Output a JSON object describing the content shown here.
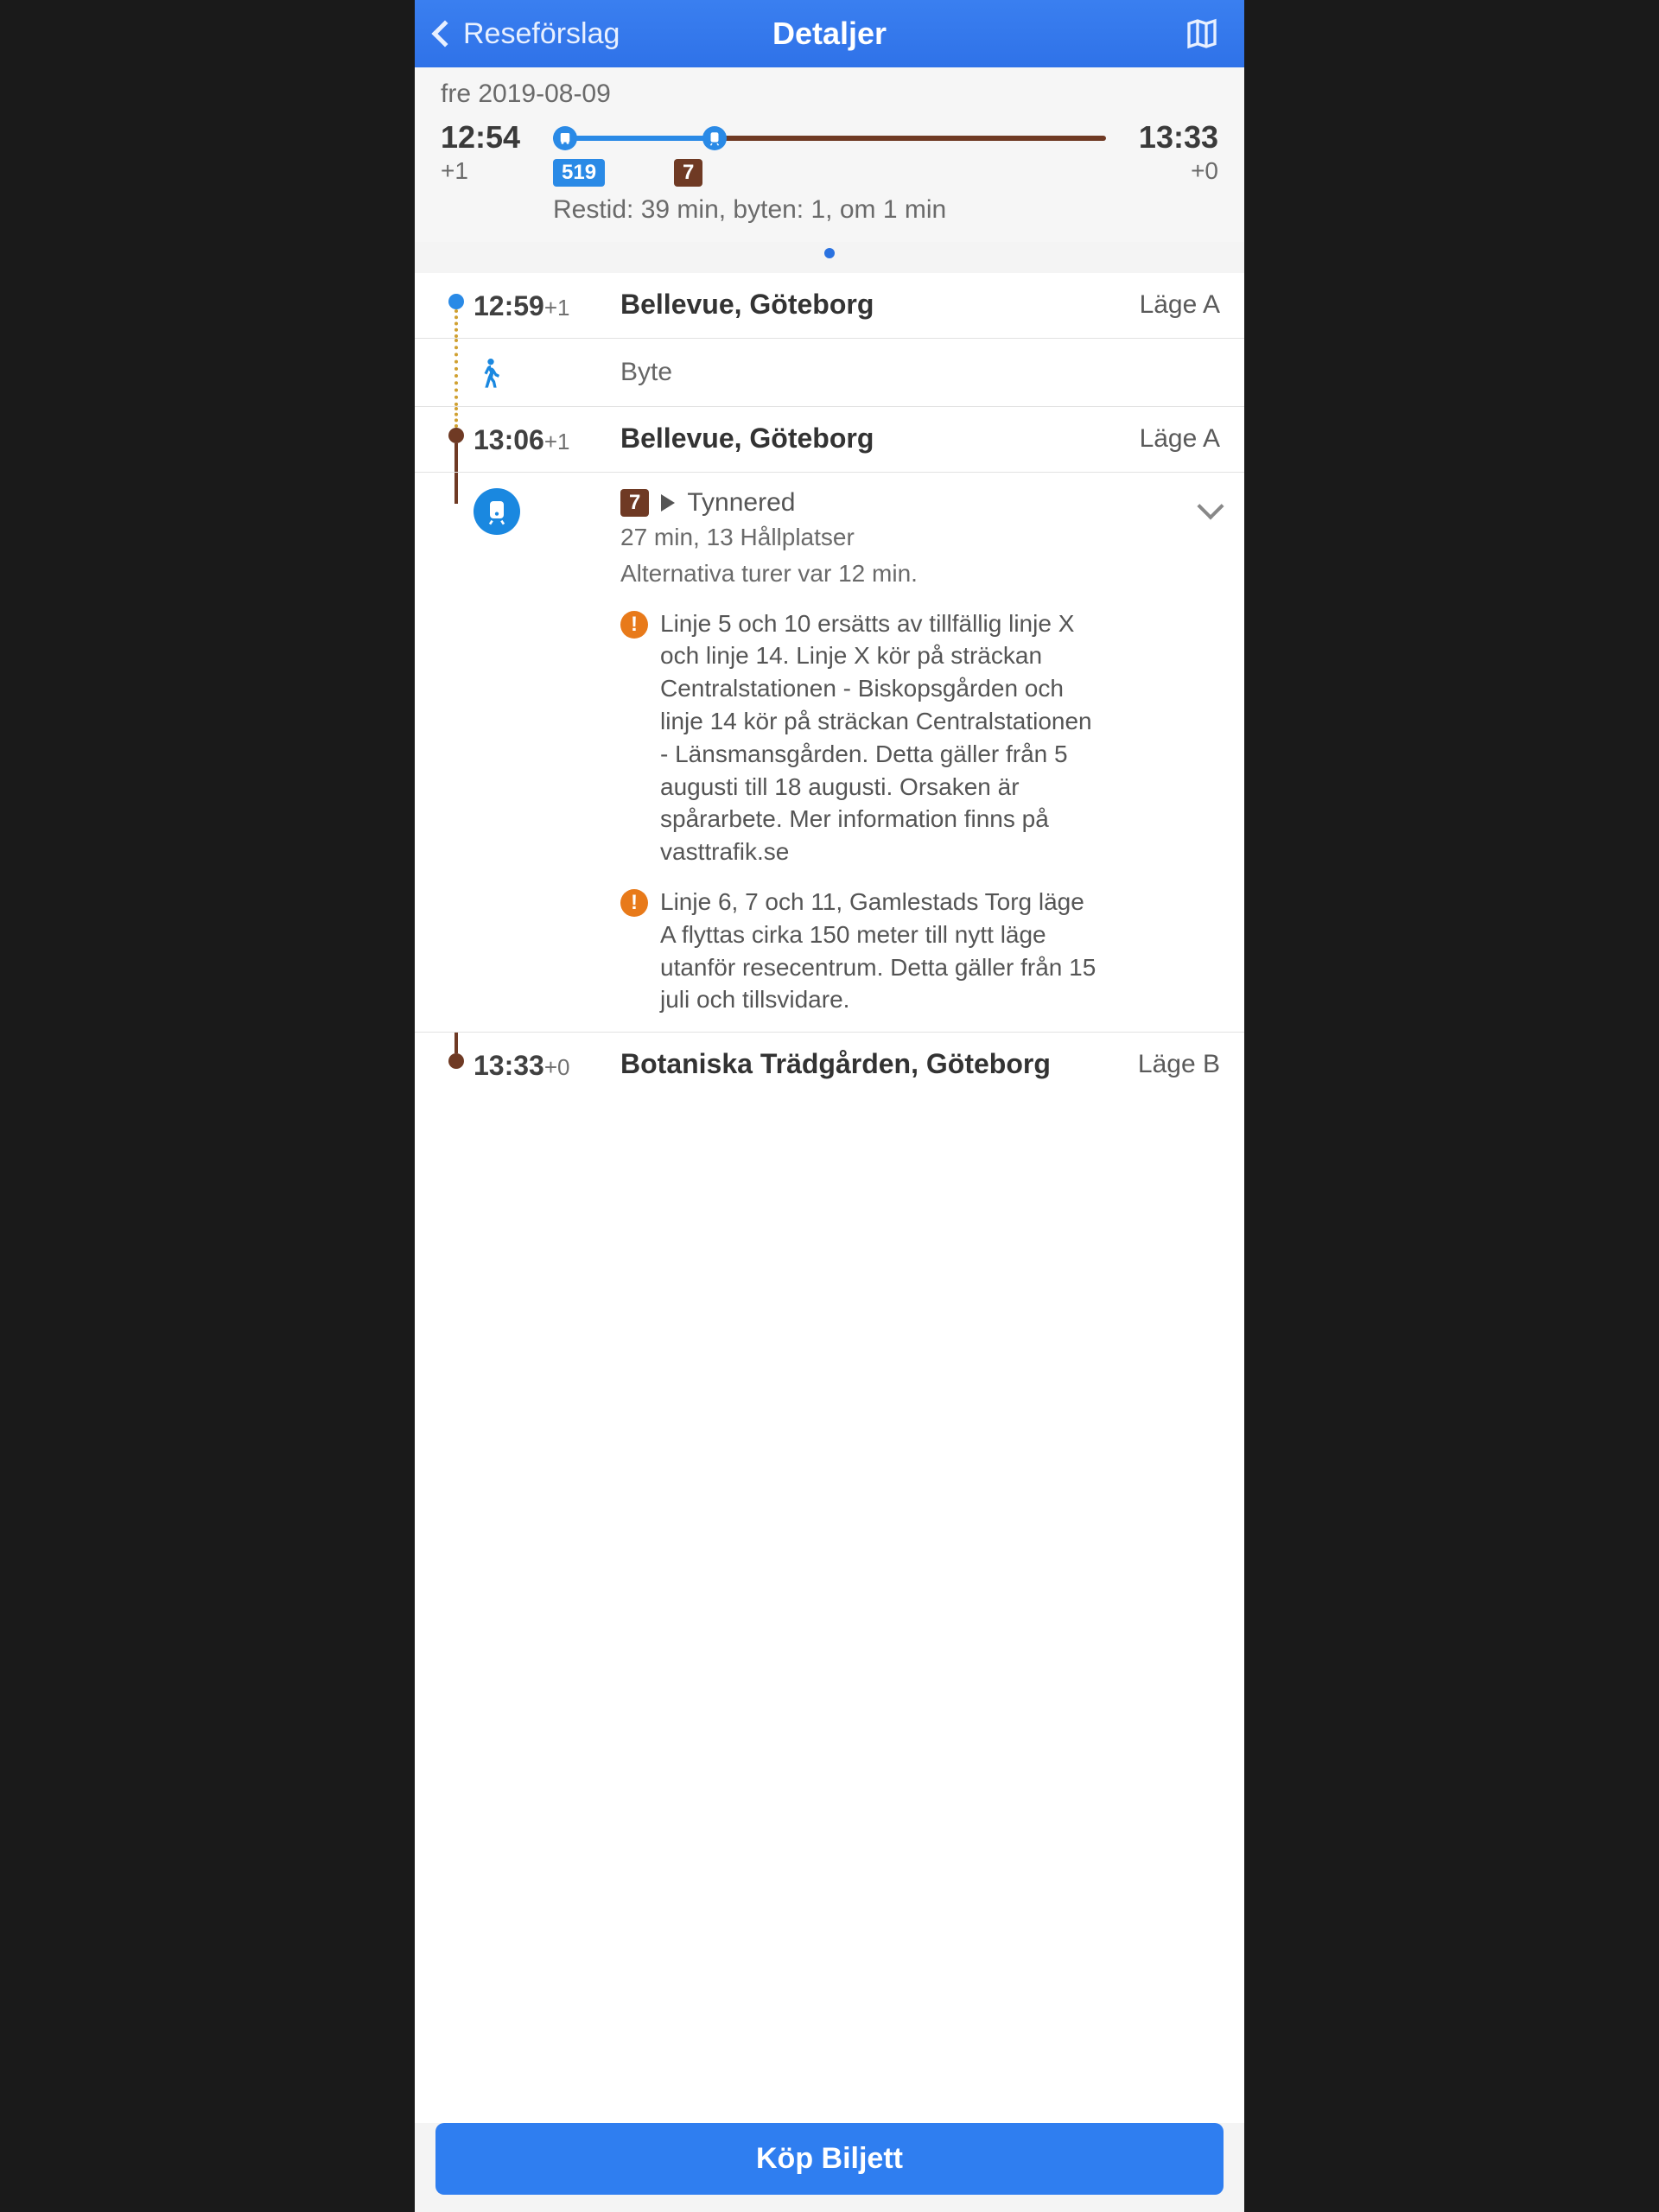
{
  "nav": {
    "back_label": "Reseförslag",
    "title": "Detaljer"
  },
  "summary": {
    "date": "fre 2019-08-09",
    "dep_time": "12:54",
    "dep_delay": "+1",
    "arr_time": "13:33",
    "arr_delay": "+0",
    "info": "Restid: 39 min,  byten: 1,  om 1 min",
    "badges": [
      {
        "label": "519",
        "color": "blue"
      },
      {
        "label": "7",
        "color": "brown"
      }
    ]
  },
  "steps": {
    "s1": {
      "time": "12:59",
      "delay": "+1",
      "name": "Bellevue, Göteborg",
      "pos": "Läge A"
    },
    "transfer": {
      "label": "Byte"
    },
    "s2": {
      "time": "13:06",
      "delay": "+1",
      "name": "Bellevue, Göteborg",
      "pos": "Läge A"
    },
    "leg": {
      "line_badge": "7",
      "direction": "Tynnered",
      "detail1": "27 min, 13 Hållplatser",
      "detail2": "Alternativa turer var 12 min.",
      "alerts": [
        "Linje 5 och 10 ersätts av tillfällig linje X och linje 14. Linje X kör på sträckan Centralstationen - Biskopsgården och linje 14 kör på sträckan Centralstationen - Länsmansgården. Detta gäller från 5 augusti till 18 augusti. Orsaken är spårarbete. Mer information finns på vasttrafik.se",
        "Linje 6, 7 och 11, Gamlestads Torg läge A flyttas cirka 150 meter till nytt läge utanför resecentrum. Detta gäller från 15 juli och tillsvidare."
      ]
    },
    "s3": {
      "time": "13:33",
      "delay": "+0",
      "name": "Botaniska Trädgården, Göteborg",
      "pos": "Läge B"
    }
  },
  "footer": {
    "buy_label": "Köp Biljett"
  }
}
